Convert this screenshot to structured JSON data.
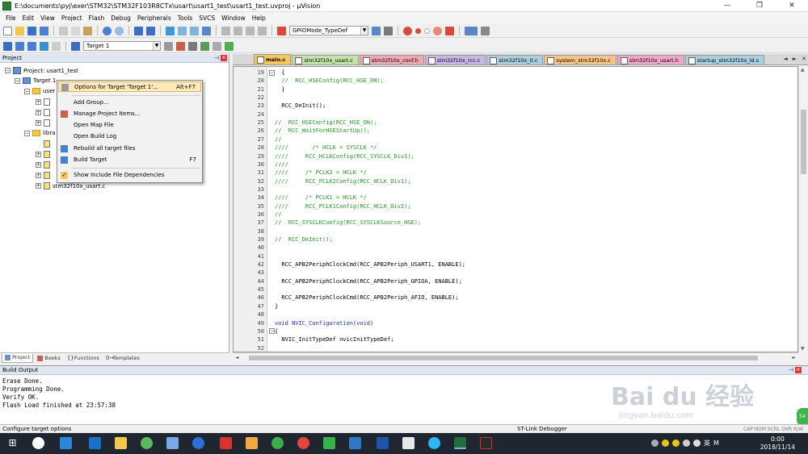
{
  "window": {
    "title": "E:\\documents\\pyj\\exer\\STM32\\STM32F103R8CTx\\usart\\usart1_test\\usart1_test.uvproj - µVision",
    "min": "—",
    "max": "❐",
    "close": "✕"
  },
  "menu": [
    "File",
    "Edit",
    "View",
    "Project",
    "Flash",
    "Debug",
    "Peripherals",
    "Tools",
    "SVCS",
    "Window",
    "Help"
  ],
  "toolbar": {
    "find_combo": "GPIOMode_TypeDef",
    "target_combo": "Target 1"
  },
  "project_panel": {
    "title": "Project",
    "pin": "⊣",
    "close": "✕",
    "root": "Project: usart1_test",
    "target": "Target 1",
    "group_user": "user",
    "group_lib": "libra",
    "last_file": "stm32f10x_usart.c"
  },
  "context_menu": {
    "items": [
      {
        "label": "Options for Target 'Target 1'...",
        "shortcut": "Alt+F7"
      },
      {
        "label": "Add Group...",
        "shortcut": ""
      },
      {
        "label": "Manage Project Items...",
        "shortcut": ""
      },
      {
        "label": "Open Map File",
        "shortcut": ""
      },
      {
        "label": "Open Build Log",
        "shortcut": ""
      },
      {
        "label": "Rebuild all target files",
        "shortcut": ""
      },
      {
        "label": "Build Target",
        "shortcut": "F7"
      },
      {
        "label": "Show Include File Dependencies",
        "shortcut": ""
      }
    ]
  },
  "project_tabs": [
    "Project",
    "Books",
    "Functions",
    "Templates"
  ],
  "editor_tabs": [
    {
      "label": "main.c",
      "color": "#f7c65a",
      "active": true
    },
    {
      "label": "stm32f10x_usart.c",
      "color": "#c4e3a9",
      "active": false
    },
    {
      "label": "stm32f10x_conf.h",
      "color": "#f0a7b1",
      "active": false
    },
    {
      "label": "stm32f10x_rcc.c",
      "color": "#c8b7e5",
      "active": false
    },
    {
      "label": "stm32f10x_it.c",
      "color": "#a9cfe0",
      "active": false
    },
    {
      "label": "system_stm32f10x.c",
      "color": "#f7c48a",
      "active": false
    },
    {
      "label": "stm32f10x_usart.h",
      "color": "#f0a7c6",
      "active": false
    },
    {
      "label": "startup_stm32f10x_ld.s",
      "color": "#a9cfe0",
      "active": false
    }
  ],
  "editor_nav": {
    "left": "◄",
    "right": "►",
    "close": "✕"
  },
  "code": [
    {
      "n": "19",
      "t": "  {",
      "c": "nm",
      "f": "−"
    },
    {
      "n": "20",
      "t": "  //  RCC_HSEConfig(RCC_HSE_ON);",
      "c": "cm",
      "f": ""
    },
    {
      "n": "21",
      "t": "  }",
      "c": "nm",
      "f": ""
    },
    {
      "n": "22",
      "t": "",
      "c": "nm",
      "f": ""
    },
    {
      "n": "23",
      "t": "  RCC_DeInit();",
      "c": "nm",
      "f": ""
    },
    {
      "n": "24",
      "t": "",
      "c": "nm",
      "f": ""
    },
    {
      "n": "25",
      "t": "//  RCC_HSEConfig(RCC_HSE_ON);",
      "c": "cm",
      "f": ""
    },
    {
      "n": "26",
      "t": "//  RCC_WaitForHSEStartUp();",
      "c": "cm",
      "f": ""
    },
    {
      "n": "27",
      "t": "//",
      "c": "cm",
      "f": ""
    },
    {
      "n": "28",
      "t": "////       /* HCLK = SYSCLK */",
      "c": "cm",
      "f": ""
    },
    {
      "n": "29",
      "t": "////     RCC_HCLKConfig(RCC_SYSCLK_Div1);",
      "c": "cm",
      "f": ""
    },
    {
      "n": "30",
      "t": "////",
      "c": "cm",
      "f": ""
    },
    {
      "n": "31",
      "t": "////     /* PCLK2 = HCLK */",
      "c": "cm",
      "f": ""
    },
    {
      "n": "32",
      "t": "////     RCC_PCLK2Config(RCC_HCLK_Div1);",
      "c": "cm",
      "f": ""
    },
    {
      "n": "33",
      "t": "",
      "c": "nm",
      "f": ""
    },
    {
      "n": "34",
      "t": "////     /* PCLK1 = HCLK */",
      "c": "cm",
      "f": ""
    },
    {
      "n": "35",
      "t": "////     RCC_PCLK1Config(RCC_HCLK_Div2);",
      "c": "cm",
      "f": ""
    },
    {
      "n": "36",
      "t": "//",
      "c": "cm",
      "f": ""
    },
    {
      "n": "37",
      "t": "//  RCC_SYSCLKConfig(RCC_SYSCLKSource_HSE);",
      "c": "cm",
      "f": ""
    },
    {
      "n": "38",
      "t": "",
      "c": "nm",
      "f": ""
    },
    {
      "n": "39",
      "t": "//  RCC_DeInit();",
      "c": "cm",
      "f": ""
    },
    {
      "n": "40",
      "t": "",
      "c": "nm",
      "f": ""
    },
    {
      "n": "41",
      "t": "",
      "c": "nm",
      "f": ""
    },
    {
      "n": "42",
      "t": "  RCC_APB2PeriphClockCmd(RCC_APB2Periph_USART1, ENABLE);",
      "c": "nm",
      "f": ""
    },
    {
      "n": "43",
      "t": "",
      "c": "nm",
      "f": ""
    },
    {
      "n": "44",
      "t": "  RCC_APB2PeriphClockCmd(RCC_APB2Periph_GPIOA, ENABLE);",
      "c": "nm",
      "f": ""
    },
    {
      "n": "45",
      "t": "",
      "c": "nm",
      "f": ""
    },
    {
      "n": "46",
      "t": "  RCC_APB2PeriphClockCmd(RCC_APB2Periph_AFIO, ENABLE);",
      "c": "nm",
      "f": ""
    },
    {
      "n": "47",
      "t": "}",
      "c": "nm",
      "f": ""
    },
    {
      "n": "48",
      "t": "",
      "c": "nm",
      "f": ""
    },
    {
      "n": "49",
      "t": "void NVIC_Configuration(void)",
      "c": "kw",
      "f": ""
    },
    {
      "n": "50",
      "t": "{",
      "c": "nm",
      "f": "−"
    },
    {
      "n": "51",
      "t": "  NVIC_InitTypeDef nvicInitTypeDef;",
      "c": "nm",
      "f": ""
    },
    {
      "n": "52",
      "t": "",
      "c": "nm",
      "f": ""
    }
  ],
  "build": {
    "title": "Build Output",
    "pin": "⊣",
    "close": "✕",
    "lines": [
      "Erase Done.",
      "Programming Done.",
      "Verify OK.",
      "Flash Load finished at 23:57:38"
    ]
  },
  "status": {
    "left": "Configure target options",
    "debugger": "ST-Link Debugger",
    "right": "CAP NUM SCRL OVR R/W"
  },
  "taskbar": {
    "ime": "英",
    "ime2": "M",
    "time": "0:00",
    "date": "2018/11/14"
  },
  "watermark": {
    "brand": "Bai du 经验",
    "site": "jingyan.baidu.com"
  },
  "badge": "54"
}
